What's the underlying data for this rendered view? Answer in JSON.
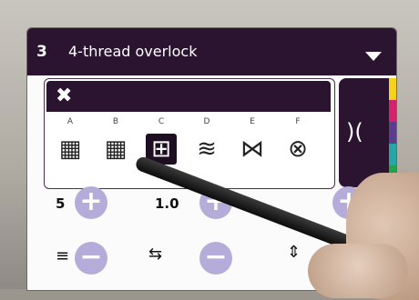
{
  "header": {
    "number": "3",
    "title": "4-thread overlock"
  },
  "stitches": [
    {
      "label": "A",
      "icon": "overlock-stitch-a-icon",
      "glyph": "▦"
    },
    {
      "label": "B",
      "icon": "overlock-stitch-b-icon",
      "glyph": "▦"
    },
    {
      "label": "C",
      "icon": "overlock-stitch-c-icon",
      "glyph": "⊞"
    },
    {
      "label": "D",
      "icon": "overlock-stitch-d-icon",
      "glyph": "≋"
    },
    {
      "label": "E",
      "icon": "overlock-stitch-e-icon",
      "glyph": "⋈"
    },
    {
      "label": "F",
      "icon": "overlock-stitch-f-icon",
      "glyph": "⊗"
    }
  ],
  "selected_stitch": "C",
  "controls": {
    "value_left": "5",
    "value_center": "1.0"
  },
  "side_colors": [
    "#f6d21a",
    "#d4236d",
    "#5a3d8c",
    "#27a6a5",
    "#1fa34d"
  ]
}
